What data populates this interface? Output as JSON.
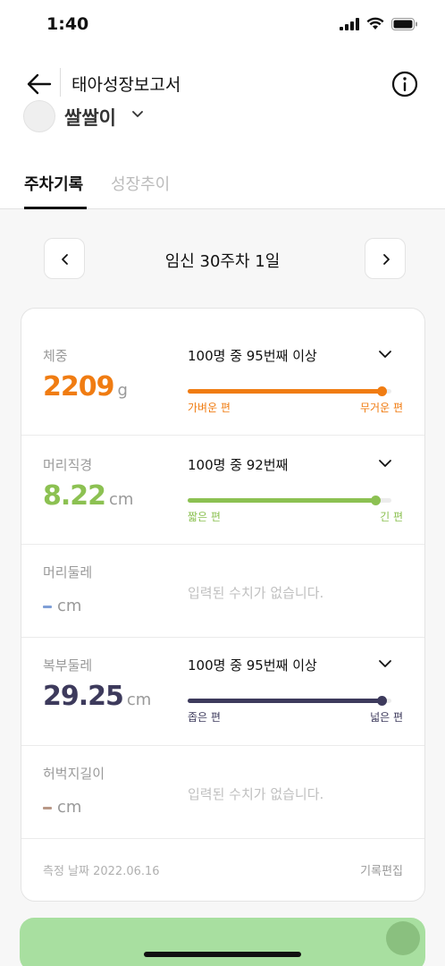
{
  "status_bar": {
    "time": "1:40"
  },
  "appbar": {
    "title": "태아성장보고서"
  },
  "baby": {
    "name": "쌀쌀이"
  },
  "tabs": [
    {
      "label": "주차기록",
      "active": true
    },
    {
      "label": "성장추이",
      "active": false
    }
  ],
  "week_nav": {
    "label": "임신 30주차 1일"
  },
  "measurements": [
    {
      "label": "체중",
      "value": "2209",
      "unit": "g",
      "color": "#f07c12",
      "rank": "100명 중 95번째 이상",
      "percentile": 0.95,
      "low_label": "가벼운 편",
      "high_label": "무거운 편"
    },
    {
      "label": "머리직경",
      "value": "8.22",
      "unit": "cm",
      "color": "#8cc152",
      "rank": "100명 중 92번째",
      "percentile": 0.92,
      "low_label": "짧은 편",
      "high_label": "긴 편"
    },
    {
      "label": "머리둘레",
      "unit": "cm",
      "color": "#7f9fd6",
      "empty_message": "입력된 수치가 없습니다."
    },
    {
      "label": "복부둘레",
      "value": "29.25",
      "unit": "cm",
      "color": "#3d3a5c",
      "rank": "100명 중 95번째 이상",
      "percentile": 0.95,
      "low_label": "좁은 편",
      "high_label": "넓은 편"
    },
    {
      "label": "허벅지길이",
      "unit": "cm",
      "color": "#b99887",
      "empty_message": "입력된 수치가 없습니다."
    }
  ],
  "footer": {
    "measure_date": "측정 날짜 2022.06.16",
    "edit_label": "기록편집"
  }
}
